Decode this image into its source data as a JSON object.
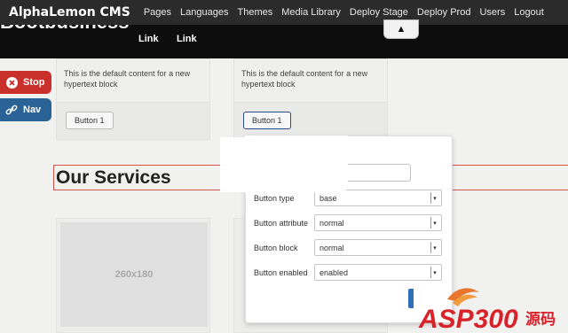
{
  "cms_bar": {
    "brand": "AlphaLemon CMS",
    "menu": [
      "Pages",
      "Languages",
      "Themes",
      "Media Library",
      "Deploy Stage",
      "Deploy Prod",
      "Users",
      "Logout"
    ]
  },
  "site_header": {
    "title": "Bootbusiness",
    "links": [
      "Link",
      "Link"
    ],
    "collapse_icon": "triangle-up-icon"
  },
  "side_buttons": {
    "stop_label": "Stop",
    "nav_label": "Nav"
  },
  "blocks": [
    {
      "text": "This is the default content for a new hypertext block",
      "button": "Button 1"
    },
    {
      "text": "This is the default content for a new hypertext block",
      "button": "Button 1"
    }
  ],
  "services": {
    "heading": "Our Services",
    "thumbnail_placeholder": "260x180"
  },
  "popover": {
    "fields": [
      {
        "label": "Button type",
        "value": "base"
      },
      {
        "label": "Button attribute",
        "value": "normal"
      },
      {
        "label": "Button block",
        "value": "normal"
      },
      {
        "label": "Button enabled",
        "value": "enabled"
      }
    ]
  },
  "watermark": {
    "text": "ASP300",
    "suffix": "源码"
  },
  "colors": {
    "cms_bar": "#2b2b2b",
    "site_header": "#0d0d0d",
    "stop_button": "#c9302c",
    "nav_button": "#2a6496",
    "services_outline": "#d9534f"
  }
}
